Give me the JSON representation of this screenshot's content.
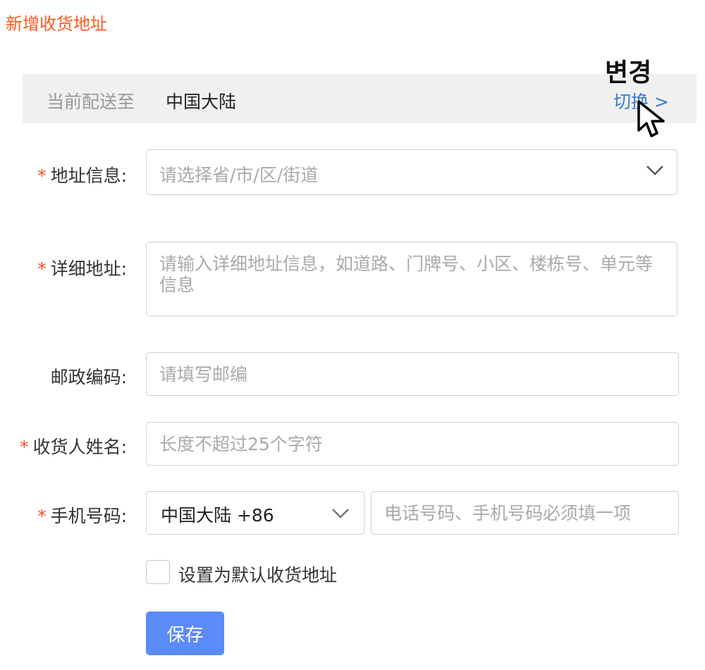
{
  "page": {
    "title": "新增收货地址"
  },
  "region": {
    "label": "当前配送至",
    "value": "中国大陆",
    "switch_label": "切换 >"
  },
  "annotation": {
    "label": "변경"
  },
  "form": {
    "address": {
      "required": "*",
      "label": "地址信息:",
      "placeholder": "请选择省/市/区/街道"
    },
    "detail": {
      "required": "*",
      "label": "详细地址:",
      "placeholder": "请输入详细地址信息，如道路、门牌号、小区、楼栋号、单元等信息"
    },
    "postcode": {
      "label": "邮政编码:",
      "placeholder": "请填写邮编"
    },
    "name": {
      "required": "*",
      "label": "收货人姓名:",
      "placeholder": "长度不超过25个字符"
    },
    "phone": {
      "required": "*",
      "label": "手机号码:",
      "country_code": "中国大陆 +86",
      "placeholder": "电话号码、手机号码必须填一项"
    },
    "default_checkbox": {
      "label": "设置为默认收货地址",
      "checked": false
    },
    "save_label": "保存"
  },
  "colors": {
    "accent": "#ff5a1f",
    "link": "#3a7ad6",
    "button": "#5b8bf7",
    "required": "#ff4a2a"
  },
  "icons": [
    "chevron-down-icon",
    "mouse-cursor-icon",
    "checkbox-icon"
  ]
}
